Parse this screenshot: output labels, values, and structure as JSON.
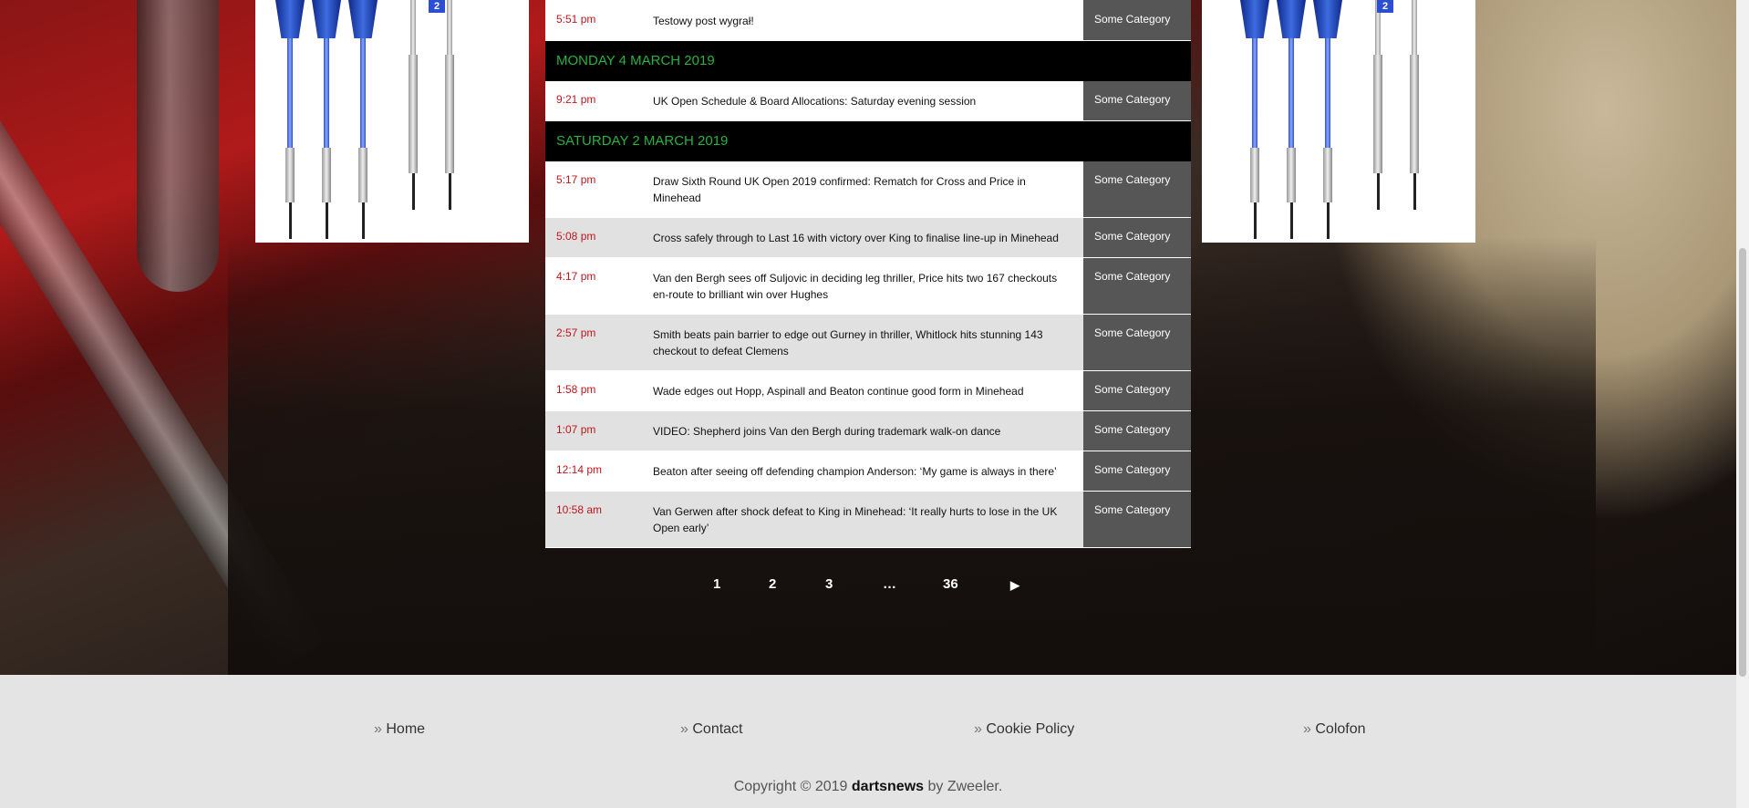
{
  "rows": [
    {
      "kind": "news",
      "shade": "white",
      "time": "5:51 pm",
      "title": "Testowy post wygrał!",
      "category": "Some Category"
    },
    {
      "kind": "day",
      "label": "MONDAY 4 MARCH 2019"
    },
    {
      "kind": "news",
      "shade": "white",
      "time": "9:21 pm",
      "title": "UK Open Schedule & Board Allocations: Saturday evening session",
      "category": "Some Category"
    },
    {
      "kind": "day",
      "label": "SATURDAY 2 MARCH 2019"
    },
    {
      "kind": "news",
      "shade": "white",
      "time": "5:17 pm",
      "title": "Draw Sixth Round UK Open 2019 confirmed: Rematch for Cross and Price in Minehead",
      "category": "Some Category"
    },
    {
      "kind": "news",
      "shade": "grey",
      "time": "5:08 pm",
      "title": "Cross safely through to Last 16 with victory over King to finalise line-up in Minehead",
      "category": "Some Category"
    },
    {
      "kind": "news",
      "shade": "white",
      "time": "4:17 pm",
      "title": "Van den Bergh sees off Suljovic in deciding leg thriller, Price hits two 167 checkouts en-route to brilliant win over Hughes",
      "category": "Some Category"
    },
    {
      "kind": "news",
      "shade": "grey",
      "time": "2:57 pm",
      "title": "Smith beats pain barrier to edge out Gurney in thriller, Whitlock hits stunning 143 checkout to defeat Clemens",
      "category": "Some Category"
    },
    {
      "kind": "news",
      "shade": "white",
      "time": "1:58 pm",
      "title": "Wade edges out Hopp, Aspinall and Beaton continue good form in Minehead",
      "category": "Some Category"
    },
    {
      "kind": "news",
      "shade": "grey",
      "time": "1:07 pm",
      "title": "VIDEO: Shepherd joins Van den Bergh during trademark walk-on dance",
      "category": "Some Category"
    },
    {
      "kind": "news",
      "shade": "white",
      "time": "12:14 pm",
      "title": "Beaton after seeing off defending champion Anderson: ‘My game is always in there’",
      "category": "Some Category"
    },
    {
      "kind": "news",
      "shade": "grey",
      "time": "10:58 am",
      "title": "Van Gerwen after shock defeat to King in Minehead: ‘It really hurts to lose in the UK Open early’",
      "category": "Some Category"
    }
  ],
  "pagination": {
    "pages": [
      "1",
      "2",
      "3",
      "…",
      "36"
    ],
    "next": "▶"
  },
  "promo": {
    "badge": "2"
  },
  "footer": {
    "links": [
      "Home",
      "Contact",
      "Cookie Policy",
      "Colofon"
    ],
    "prefix": "»",
    "copyright_before": "Copyright © 2019",
    "brand": "dartsnews",
    "copyright_after": "by Zweeler."
  },
  "colors": {
    "time": "#c0151b",
    "day_heading": "#28b33c",
    "category_bg": "#565656",
    "footer_bg": "#e4e4e4"
  },
  "icons": {
    "next": "play-triangle-icon"
  }
}
